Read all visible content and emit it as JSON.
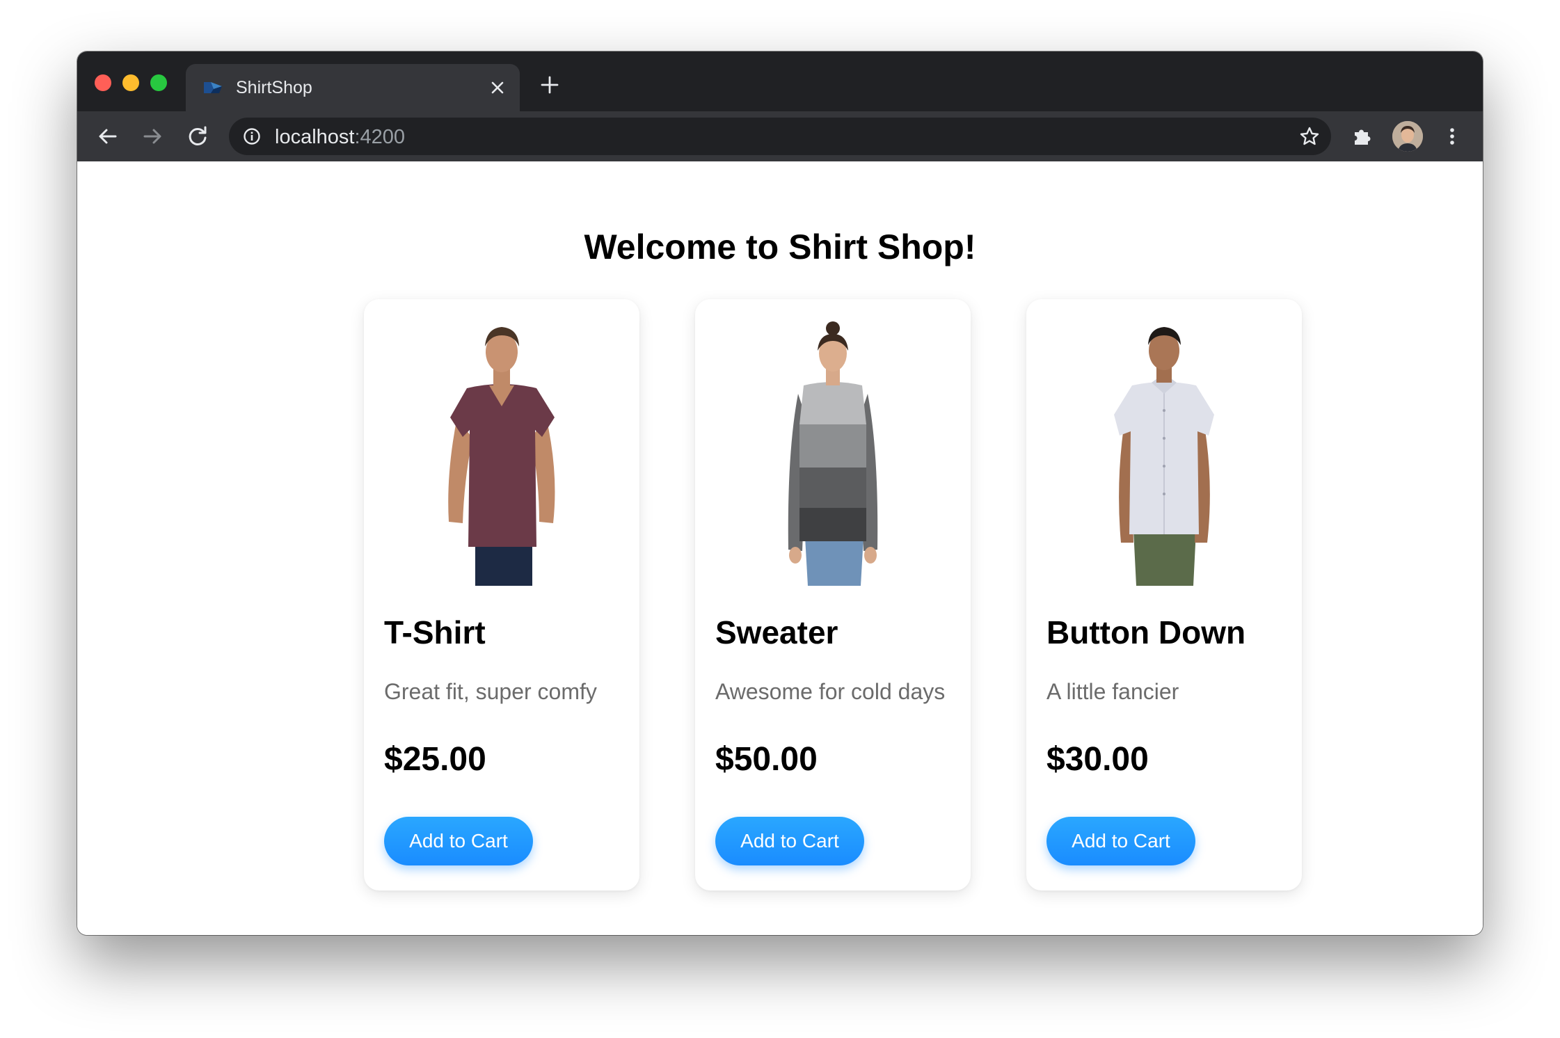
{
  "colors": {
    "tabstrip": "#202124",
    "toolbar": "#35363a",
    "accent": "#1a8cff",
    "description": "#6b6b6b"
  },
  "tab": {
    "title": "ShirtShop",
    "favicon": "app-icon"
  },
  "toolbar": {
    "url_host": "localhost",
    "url_port": ":4200"
  },
  "page": {
    "title": "Welcome to Shirt Shop!"
  },
  "products": [
    {
      "name": "T-Shirt",
      "description": "Great fit, super comfy",
      "price": "$25.00",
      "button": "Add to Cart",
      "shirt_color": "#6b3a48"
    },
    {
      "name": "Sweater",
      "description": "Awesome for cold days",
      "price": "$50.00",
      "button": "Add to Cart",
      "shirt_color": "#8d8f91"
    },
    {
      "name": "Button Down",
      "description": "A little fancier",
      "price": "$30.00",
      "button": "Add to Cart",
      "shirt_color": "#dfe1ea"
    }
  ]
}
